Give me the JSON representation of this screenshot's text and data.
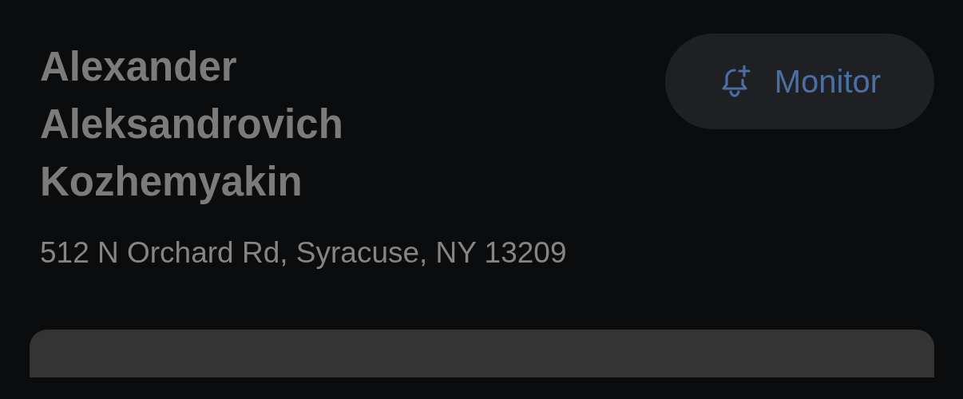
{
  "person": {
    "name": "Alexander Aleksandrovich Kozhemyakin",
    "address": "512 N Orchard Rd, Syracuse, NY 13209"
  },
  "monitor_button": {
    "label": "Monitor"
  }
}
